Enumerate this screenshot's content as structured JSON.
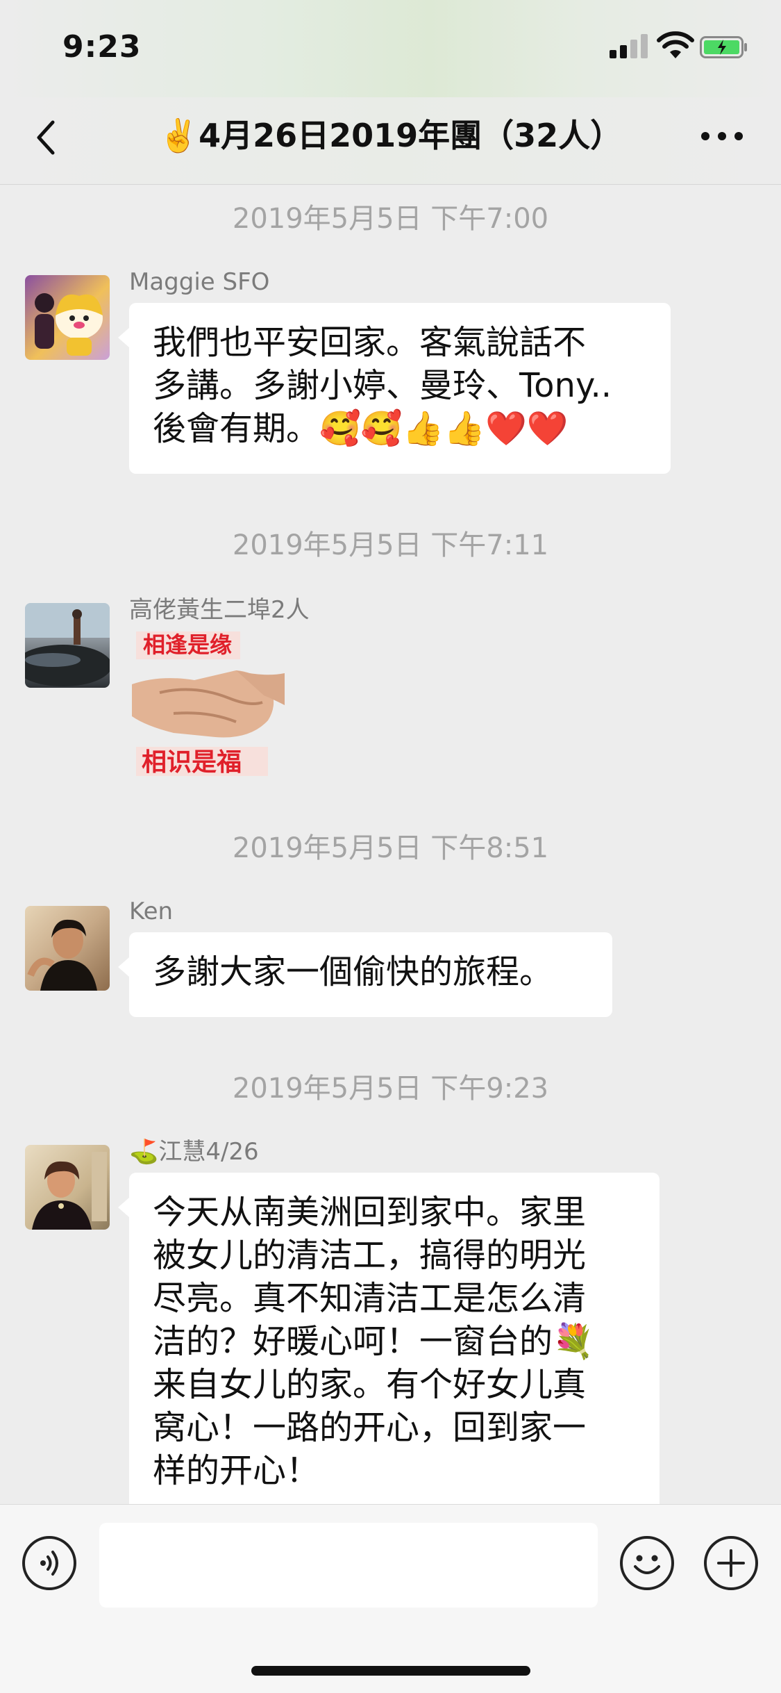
{
  "status_bar": {
    "time": "9:23"
  },
  "header": {
    "title": "✌️4月26日2019年團（32人）"
  },
  "messages": [
    {
      "timestamp": "2019年5月5日 下午7:00",
      "sender": "Maggie SFO",
      "lines": [
        "我們也平安回家。客氣說話不",
        "多講。多謝小婷、曼玲、Tony..",
        "後會有期。🥰🥰👍👍❤️❤️"
      ]
    },
    {
      "timestamp": "2019年5月5日 下午7:11",
      "sender": "高佬黃生二埠2人",
      "sticker": {
        "top_text": "相逢是缘",
        "bottom_text": "相识是福"
      }
    },
    {
      "timestamp": "2019年5月5日 下午8:51",
      "sender": "Ken",
      "lines": [
        "多謝大家一個偷快的旅程。"
      ]
    },
    {
      "timestamp": "2019年5月5日 下午9:23",
      "sender": "⛳江慧4/26",
      "lines": [
        "今天从南美洲回到家中。家里",
        "被女儿的清洁工，搞得的明光",
        "尽亮。真不知清洁工是怎么清",
        "洁的？好暖心呵！一窗台的💐",
        "来自女儿的家。有个好女儿真",
        "窝心！一路的开心，回到家一",
        "样的开心！"
      ]
    }
  ],
  "input_bar": {
    "voice_icon": "voice-icon",
    "emoji_icon": "emoji-icon",
    "plus_icon": "plus-icon"
  },
  "colors": {
    "background": "#ededed",
    "bubble": "#ffffff",
    "timestamp": "#a4a4a4",
    "sender": "#7b7b7b"
  }
}
